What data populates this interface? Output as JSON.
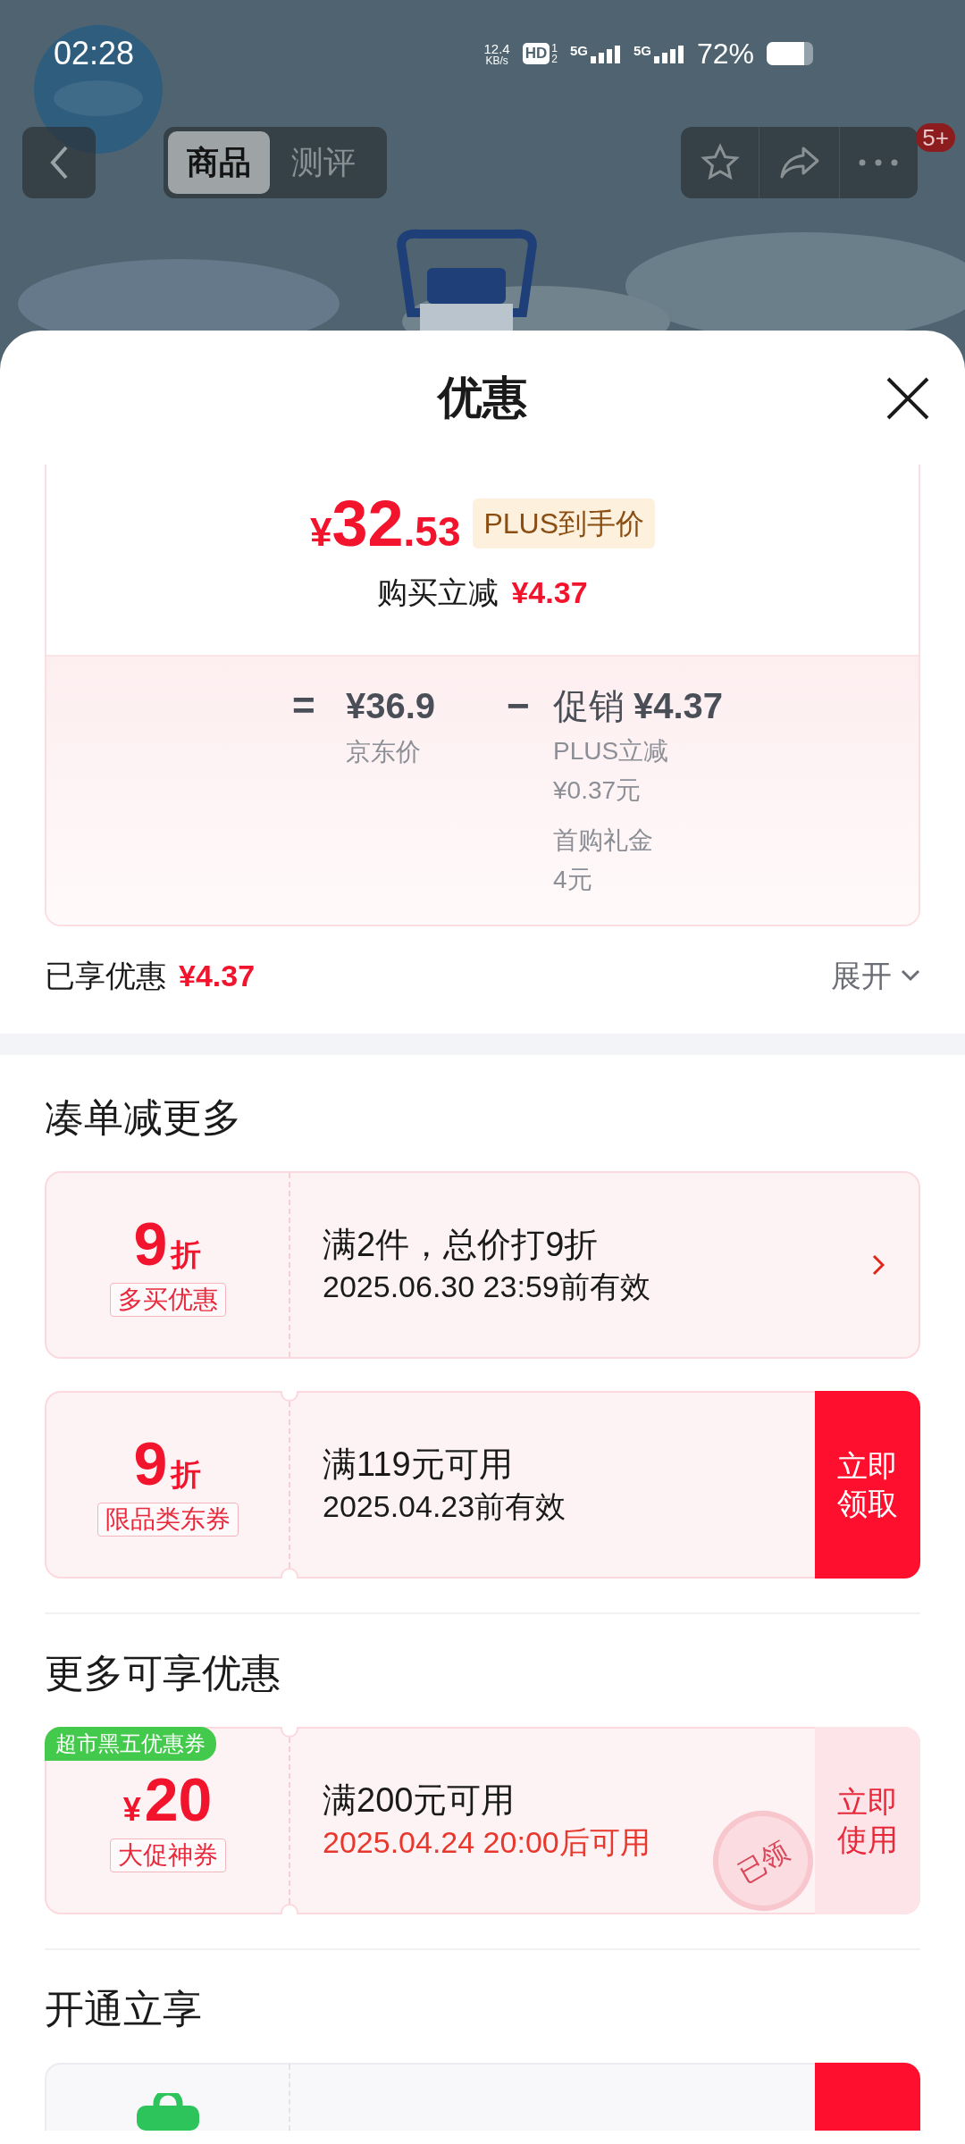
{
  "status_bar": {
    "time": "02:28",
    "net_speed": "12.4",
    "net_unit": "KB/s",
    "hd": "HD",
    "hd_sub": [
      "1",
      "2"
    ],
    "sims": [
      "5G",
      "5G"
    ],
    "battery": "72%"
  },
  "header": {
    "tabs": [
      {
        "label": "商品",
        "selected": true
      },
      {
        "label": "测评",
        "selected": false
      }
    ],
    "badge": "5+"
  },
  "sheet": {
    "title": "优惠"
  },
  "price_card": {
    "currency": "¥",
    "price_int": "32",
    "price_dec": ".53",
    "tag": "PLUS到手价",
    "cut_label": "购买立减",
    "cut_value": "¥4.37",
    "equals": "=",
    "base_price": "¥36.9",
    "base_label": "京东价",
    "minus": "−",
    "promo_label": "促销",
    "promo_value": "¥4.37",
    "promo_items": [
      {
        "name": "PLUS立减",
        "amount": "¥0.37元"
      },
      {
        "name": "首购礼金",
        "amount": "4元"
      }
    ]
  },
  "enjoyed": {
    "label": "已享优惠",
    "value": "¥4.37",
    "expand": "展开"
  },
  "sections": [
    {
      "title": "凑单减更多",
      "coupons": [
        {
          "value": "9",
          "unit": "折",
          "tag": "多买优惠",
          "line1": "满2件，总价打9折",
          "line2": "2025.06.30 23:59前有效",
          "line2_highlight": false,
          "notched": false,
          "action": {
            "kind": "arrow"
          }
        },
        {
          "value": "9",
          "unit": "折",
          "tag": "限品类东券",
          "line1": "满119元可用",
          "line2": "2025.04.23前有效",
          "line2_highlight": false,
          "notched": true,
          "action": {
            "kind": "claim",
            "label": "立即领取"
          }
        }
      ]
    },
    {
      "title": "更多可享优惠",
      "coupons": [
        {
          "corner": "超市黑五优惠券",
          "prefix": "¥",
          "value": "20",
          "tag": "大促神券",
          "line1": "满200元可用",
          "line2": "2025.04.24 20:00后可用",
          "line2_highlight": true,
          "notched": true,
          "stamp": "已领",
          "action": {
            "kind": "use",
            "label": "立即使用"
          }
        }
      ]
    },
    {
      "title": "开通立享",
      "coupons": [
        {
          "kind": "partial",
          "notched": false,
          "action": {
            "kind": "claim"
          }
        }
      ]
    }
  ]
}
